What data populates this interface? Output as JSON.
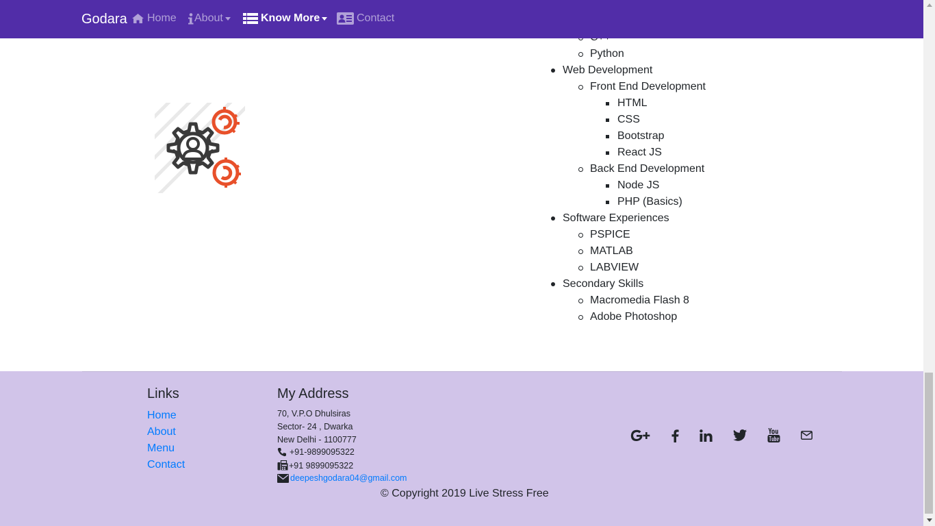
{
  "navbar": {
    "brand": "Godara",
    "items": [
      {
        "label": "Home",
        "icon": "home-icon"
      },
      {
        "label": "About",
        "icon": "info-icon",
        "dropdown": true
      },
      {
        "label": "Know More",
        "icon": "list-icon",
        "dropdown": true,
        "active": true
      },
      {
        "label": "Contact",
        "icon": "address-card-icon"
      }
    ]
  },
  "skills": {
    "partial_item": "C++",
    "python": "Python",
    "web_development": "Web Development",
    "front_end": "Front End Development",
    "html": "HTML",
    "css": "CSS",
    "bootstrap": "Bootstrap",
    "react": "React JS",
    "back_end": "Back End Development",
    "node": "Node JS",
    "php": "PHP (Basics)",
    "software": "Software Experiences",
    "pspice": "PSPICE",
    "matlab": "MATLAB",
    "labview": "LABVIEW",
    "secondary": "Secondary Skills",
    "flash": "Macromedia Flash 8",
    "photoshop": "Adobe Photoshop"
  },
  "footer": {
    "links_heading": "Links",
    "links": [
      "Home",
      "About",
      "Menu",
      "Contact"
    ],
    "address_heading": "My Address",
    "address_lines": [
      "70, V.P.O Dhulsiras",
      "Sector- 24 , Dwarka",
      "New Delhi - 1100777"
    ],
    "phone": "+91-9899095322",
    "fax": "+91 9899095322",
    "email": "deepeshgodara04@gmail.com",
    "social": [
      "google-plus-icon",
      "facebook-icon",
      "linkedin-icon",
      "twitter-icon",
      "youtube-icon",
      "envelope-icon"
    ],
    "copyright": "© Copyright 2019 Live Stress Free"
  },
  "colors": {
    "navbar": "#512DA8",
    "footer": "#D1C4E9",
    "link": "#007bff",
    "gear_accent": "#E8502A",
    "gear_dark": "#3a3a3a"
  }
}
